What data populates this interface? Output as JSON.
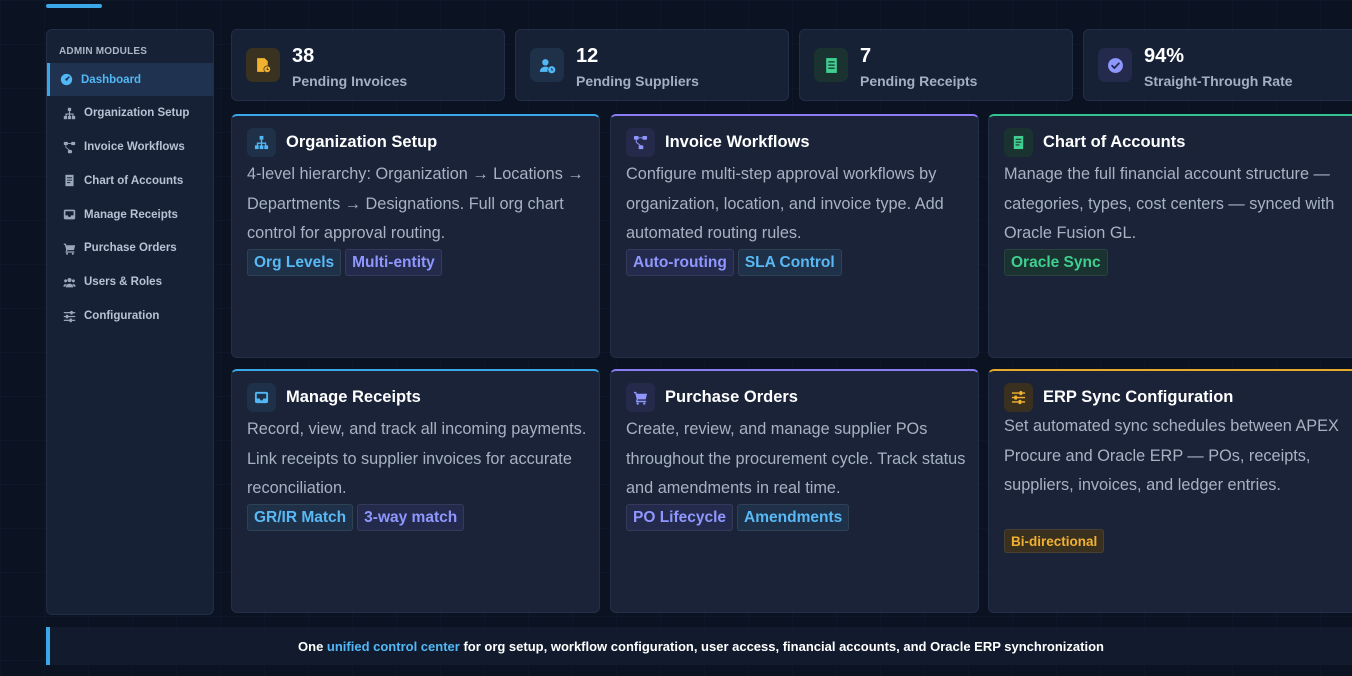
{
  "sidebar": {
    "heading": "ADMIN MODULES",
    "items": [
      {
        "label": "Dashboard",
        "icon": "dashboard-gauge-icon",
        "active": true
      },
      {
        "label": "Organization Setup",
        "icon": "org-hierarchy-icon"
      },
      {
        "label": "Invoice Workflows",
        "icon": "workflow-icon"
      },
      {
        "label": "Chart of Accounts",
        "icon": "ledger-book-icon"
      },
      {
        "label": "Manage Receipts",
        "icon": "inbox-icon"
      },
      {
        "label": "Purchase Orders",
        "icon": "cart-icon"
      },
      {
        "label": "Users & Roles",
        "icon": "users-icon"
      },
      {
        "label": "Configuration",
        "icon": "sliders-icon"
      }
    ]
  },
  "stats": [
    {
      "value": "38",
      "label": "Pending Invoices",
      "icon": "invoice-clock-icon",
      "color": "#f2b230"
    },
    {
      "value": "12",
      "label": "Pending Suppliers",
      "icon": "user-clock-icon",
      "color": "#52b8f5"
    },
    {
      "value": "7",
      "label": "Pending Receipts",
      "icon": "receipt-icon",
      "color": "#3fcf91"
    },
    {
      "value": "94%",
      "label": "Straight-Through Rate",
      "icon": "check-badge-icon",
      "color": "#8f97ff"
    }
  ],
  "cards": [
    {
      "title": "Organization Setup",
      "icon": "org-hierarchy-icon",
      "accent": "#3aa7e8",
      "description": "4-level hierarchy: Organization → Locations → Departments → Designations. Full org chart control for approval routing.",
      "tags": [
        "Org Levels",
        "Multi-entity"
      ]
    },
    {
      "title": "Invoice Workflows",
      "icon": "workflow-icon",
      "accent": "#8b7cf6",
      "description": "Configure multi-step approval workflows by organization, location, and invoice type. Add automated routing rules.",
      "tags": [
        "Auto-routing",
        "SLA Control"
      ]
    },
    {
      "title": "Chart of Accounts",
      "icon": "ledger-book-icon",
      "accent": "#34c38f",
      "description": "Manage the full financial account structure — categories, types, cost centers — synced with Oracle Fusion GL.",
      "tags": [
        "Oracle Sync"
      ]
    },
    {
      "title": "Manage Receipts",
      "icon": "inbox-icon",
      "accent": "#3aa7e8",
      "description": "Record, view, and track all incoming payments. Link receipts to supplier invoices for accurate reconciliation.",
      "tags": [
        "GR/IR Match",
        "3-way match"
      ]
    },
    {
      "title": "Purchase Orders",
      "icon": "cart-icon",
      "accent": "#8b7cf6",
      "description": "Create, review, and manage supplier POs throughout the procurement cycle. Track status and amendments in real time.",
      "tags": [
        "PO Lifecycle",
        "Amendments"
      ]
    },
    {
      "title": "ERP Sync Configuration",
      "icon": "sliders-icon",
      "accent": "#e6a92a",
      "description": "Set automated sync schedules between APEX Procure and Oracle ERP — POs, receipts, suppliers, invoices, and ledger entries.",
      "tags": [
        "Bi-directional"
      ]
    }
  ],
  "footer": {
    "prefix": "One ",
    "highlight": "unified control center",
    "suffix": " for org setup, workflow configuration, user access, financial accounts, and Oracle ERP synchronization"
  }
}
